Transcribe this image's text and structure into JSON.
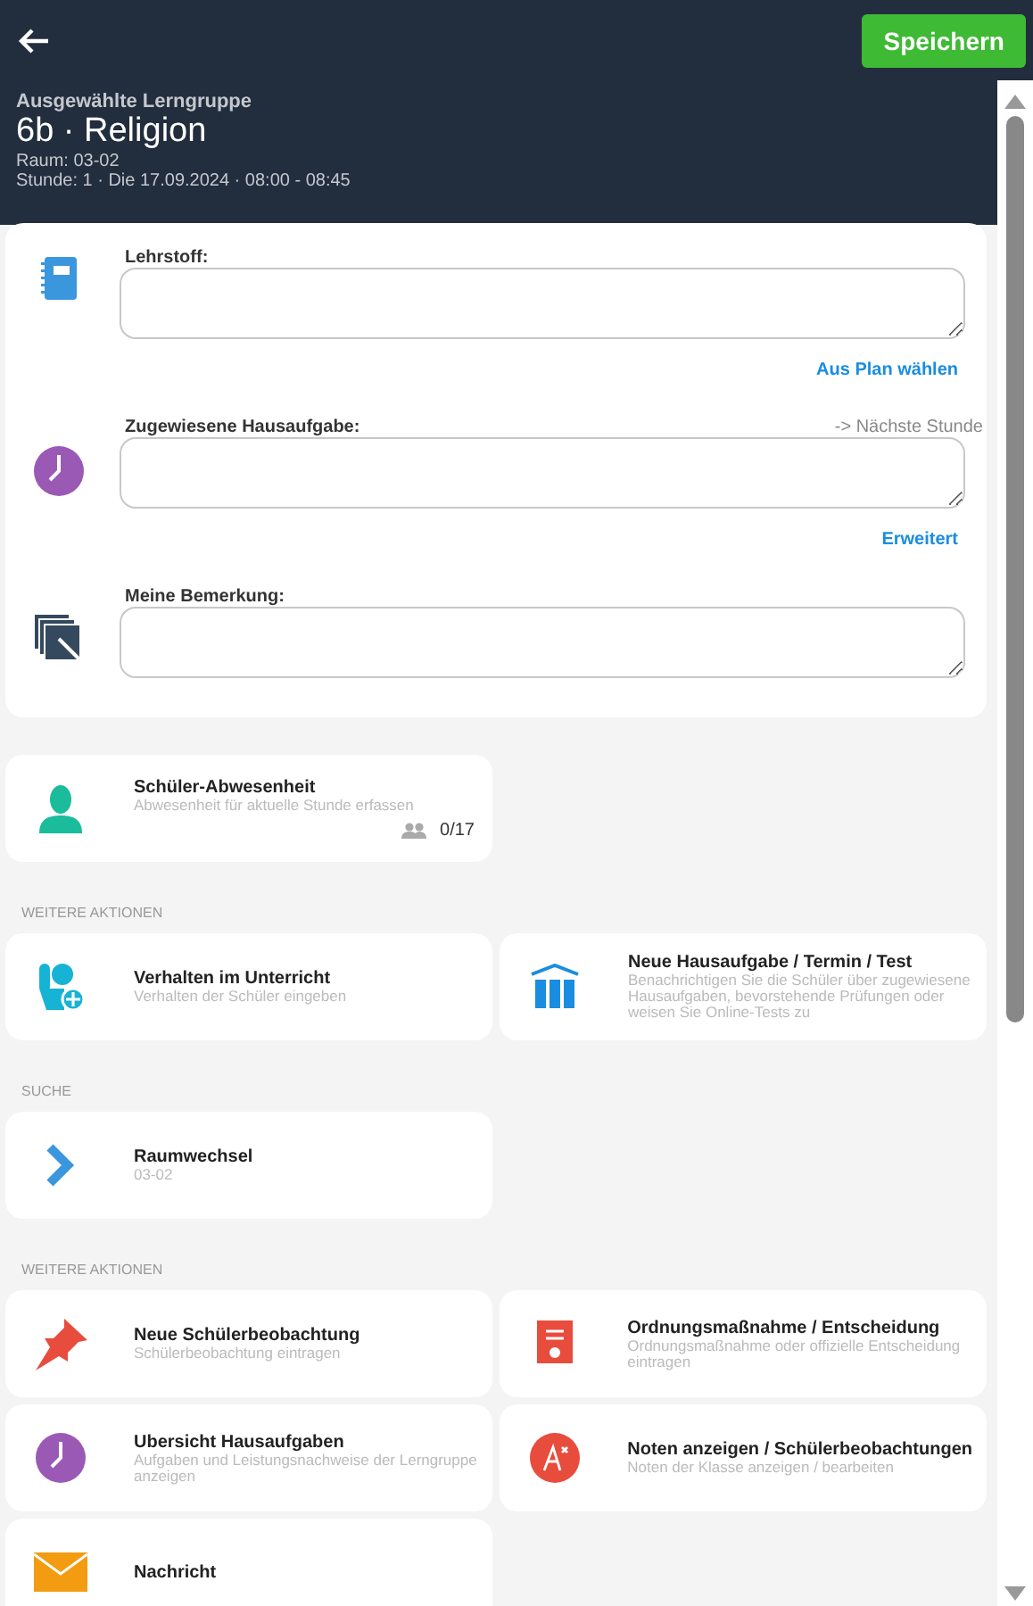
{
  "header": {
    "save_button": "Speichern",
    "group_label": "Ausgewählte Lerngruppe",
    "group_title": "6b · Religion",
    "room": "Raum: 03-02",
    "lesson": "Stunde: 1 · Die 17.09.2024 · 08:00 - 08:45"
  },
  "fields": [
    {
      "kind": "notebook",
      "label": "Lehrstoff:",
      "link": "Aus Plan wählen"
    },
    {
      "kind": "clock",
      "label": "Zugewiesene Hausaufgabe:",
      "note": "-> Nächste Stunde",
      "link": "Erweitert"
    },
    {
      "kind": "notes",
      "label": "Meine Bemerkung:"
    }
  ],
  "absence": {
    "title": "Schüler-Abwesenheit",
    "subtitle": "Abwesenheit für aktuelle Stunde erfassen",
    "count": "0/17"
  },
  "sections": [
    {
      "heading": "WEITERE AKTIONEN",
      "items": [
        {
          "kind": "hand",
          "title": "Verhalten im Unterricht",
          "subtitle": "Verhalten der Schüler eingeben"
        },
        {
          "kind": "library",
          "title": "Neue Hausaufgabe / Termin / Test",
          "subtitle": "Benachrichtigen Sie die Schüler über zugewiesene Hausaufgaben, bevorstehende Prüfungen oder weisen Sie Online-Tests zu"
        }
      ]
    },
    {
      "heading": "SUCHE",
      "items": [
        {
          "kind": "chevron",
          "title": "Raumwechsel",
          "subtitle": "03-02"
        }
      ]
    },
    {
      "heading": "WEITERE AKTIONEN",
      "items": [
        {
          "kind": "pin",
          "title": "Neue Schülerbeobachtung",
          "subtitle": "Schülerbeobachtung eintragen"
        },
        {
          "kind": "certificate",
          "title": "Ordnungsmaßnahme / Entscheidung",
          "subtitle": "Ordnungsmaßnahme oder offizielle Entscheidung eintragen"
        },
        {
          "kind": "clock",
          "title": "Ubersicht Hausaufgaben",
          "subtitle": "Aufgaben und Leistungsnachweise der Lerngruppe anzeigen"
        },
        {
          "kind": "grade",
          "title": "Noten anzeigen / Schülerbeobachtungen",
          "subtitle": "Noten der Klasse anzeigen / bearbeiten"
        },
        {
          "kind": "envelope",
          "title": "Nachricht"
        }
      ]
    }
  ]
}
